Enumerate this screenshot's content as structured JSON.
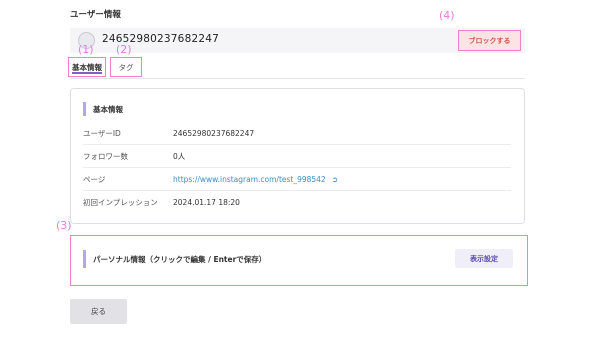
{
  "page": {
    "section_heading": "ユーザー情報"
  },
  "user": {
    "id_text": "246529802376822 47"
  },
  "buttons": {
    "block": "ブロックする",
    "display_settings": "表示設定",
    "back": "戻る"
  },
  "tabs": [
    {
      "label": "基本情報",
      "active": true
    },
    {
      "label": "タグ",
      "active": false
    }
  ],
  "basic_info": {
    "title": "基本情報",
    "rows": [
      {
        "label": "ユーザーID",
        "value": "24652980237682247"
      },
      {
        "label": "フォロワー数",
        "value": "0人"
      },
      {
        "label": "ページ",
        "value": "https://www.instagram.com/test_998542"
      },
      {
        "label": "初回インプレッション",
        "value": "2024.01.17 18:20"
      }
    ]
  },
  "personal": {
    "title": "パーソナル情報（クリックで編集 / Enterで保存）"
  },
  "annotations": {
    "a1": "(1)",
    "a2": "(2)",
    "a3": "(3)",
    "a4": "(4)"
  },
  "colors": {
    "accent": "#7b61c9",
    "annotation": "#e47be0",
    "danger": "#d9534f",
    "link": "#3a8fc4"
  }
}
